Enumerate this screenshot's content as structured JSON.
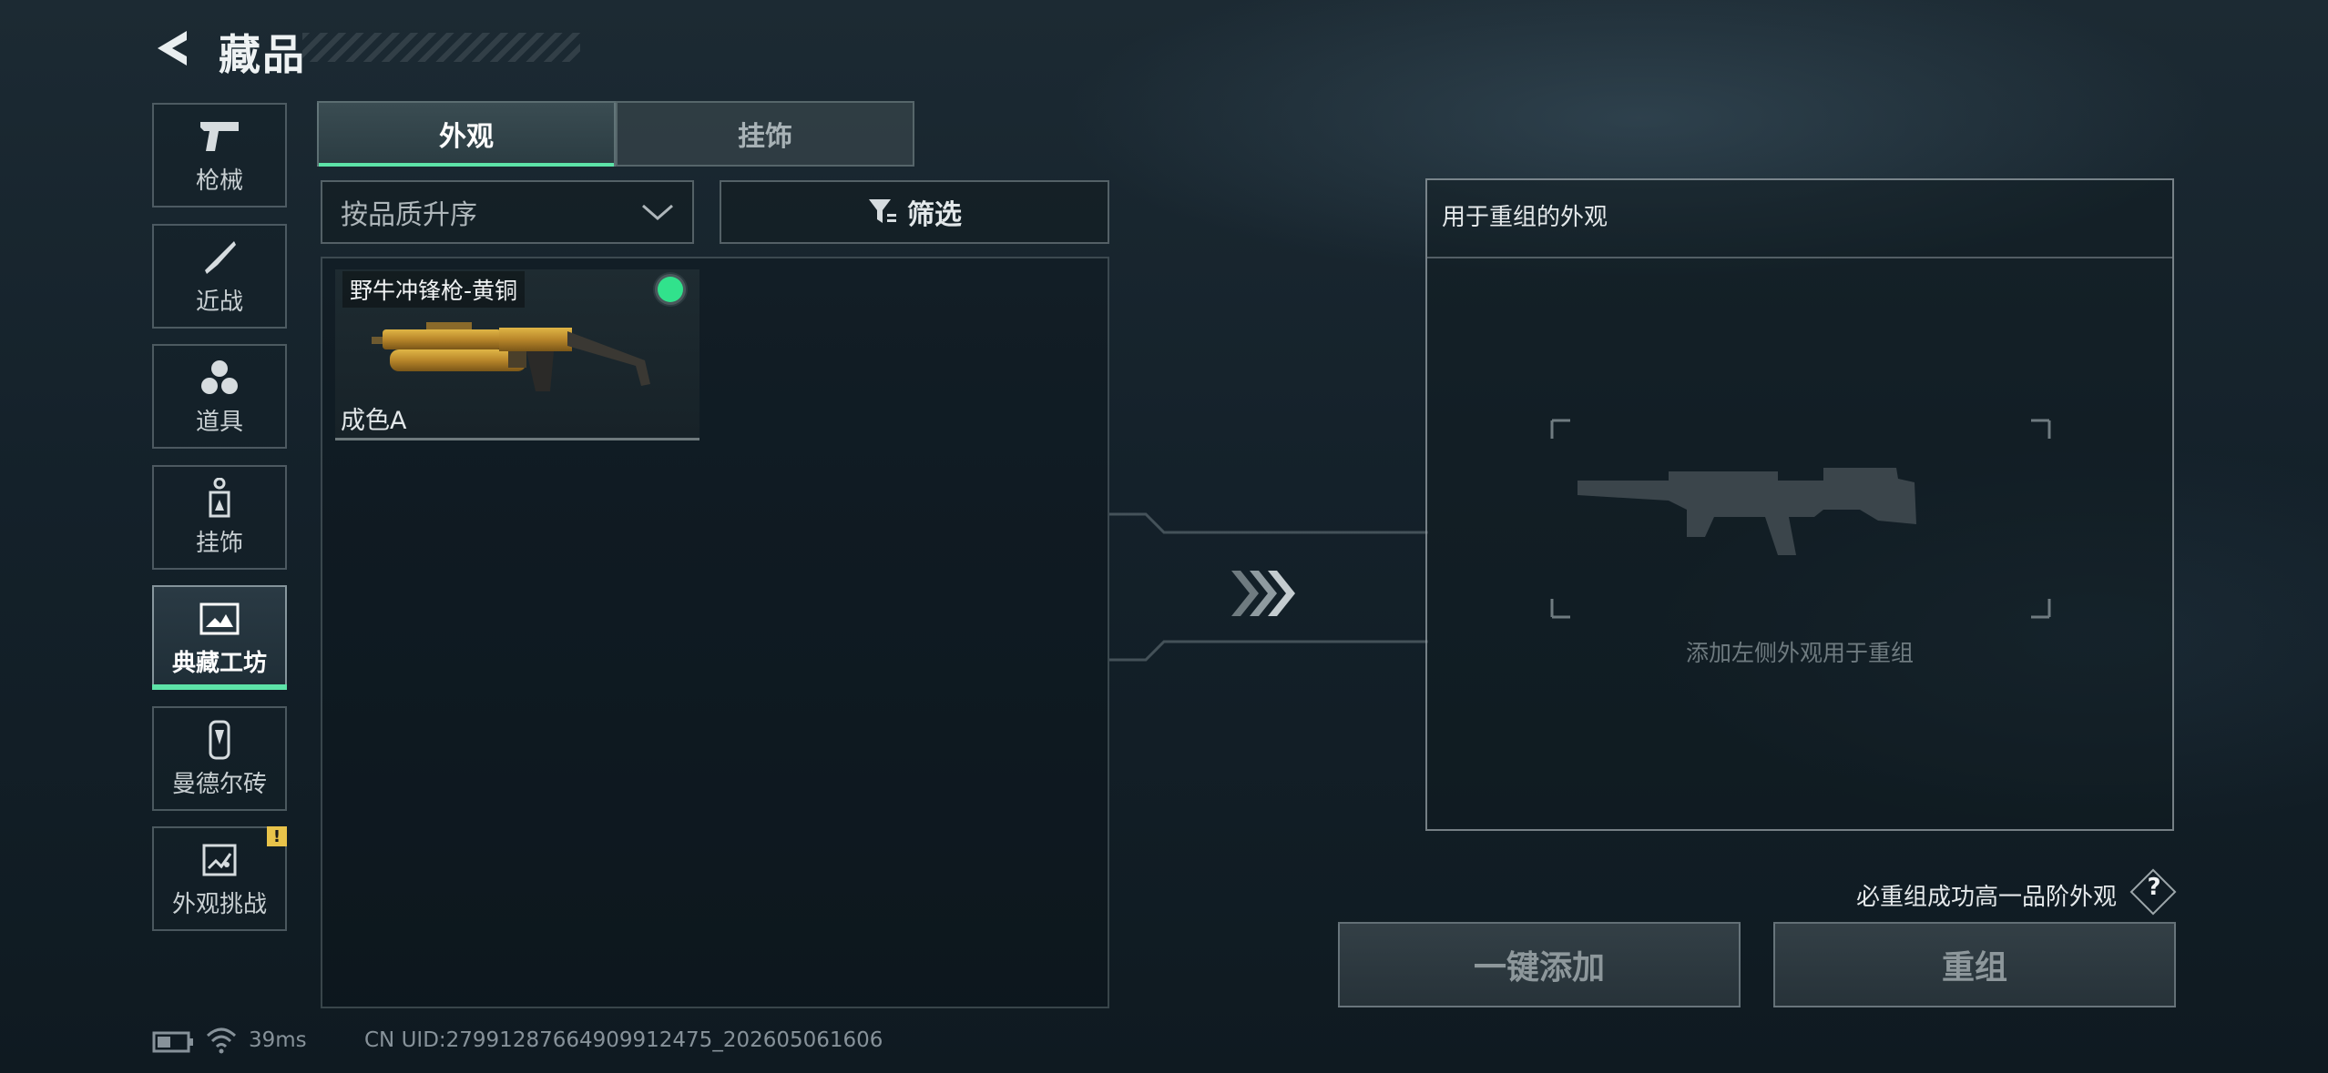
{
  "header": {
    "title": "藏品"
  },
  "sidebar": {
    "items": [
      {
        "label": "枪械",
        "icon": "pistol-icon"
      },
      {
        "label": "近战",
        "icon": "knife-icon"
      },
      {
        "label": "道具",
        "icon": "gadget-icon"
      },
      {
        "label": "挂饰",
        "icon": "charm-icon"
      },
      {
        "label": "典藏工坊",
        "icon": "workshop-icon",
        "active": true
      },
      {
        "label": "曼德尔砖",
        "icon": "mandel-brick-icon"
      },
      {
        "label": "外观挑战",
        "icon": "challenge-icon",
        "badge": "!"
      }
    ]
  },
  "tabs": [
    {
      "label": "外观",
      "active": true
    },
    {
      "label": "挂饰",
      "active": false
    }
  ],
  "sort": {
    "label": "按品质升序"
  },
  "filter": {
    "label": "筛选"
  },
  "items": [
    {
      "name": "野牛冲锋枪-黄铜",
      "grade": "成色A",
      "selected": true
    }
  ],
  "recombine": {
    "header": "用于重组的外观",
    "hint": "添加左侧外观用于重组",
    "guarantee": "必重组成功高一品阶外观",
    "help": "?",
    "add_button": "一键添加",
    "recombine_button": "重组"
  },
  "status": {
    "ping": "39ms",
    "uid": "CN UID:27991287664909912475_202605061606"
  },
  "colors": {
    "accent": "#5de3a8",
    "selected_dot": "#31e28c",
    "warning": "#e8c34a"
  }
}
